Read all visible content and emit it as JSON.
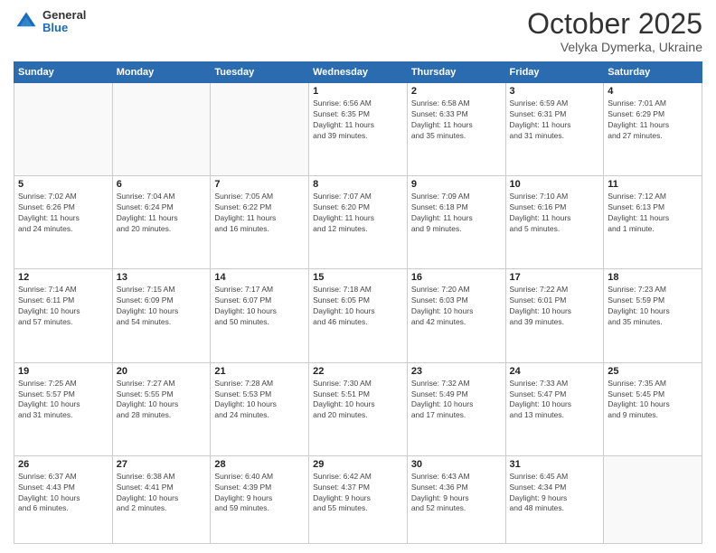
{
  "header": {
    "logo": {
      "general": "General",
      "blue": "Blue"
    },
    "title": "October 2025",
    "subtitle": "Velyka Dymerka, Ukraine"
  },
  "weekdays": [
    "Sunday",
    "Monday",
    "Tuesday",
    "Wednesday",
    "Thursday",
    "Friday",
    "Saturday"
  ],
  "weeks": [
    [
      {
        "day": "",
        "info": ""
      },
      {
        "day": "",
        "info": ""
      },
      {
        "day": "",
        "info": ""
      },
      {
        "day": "1",
        "info": "Sunrise: 6:56 AM\nSunset: 6:35 PM\nDaylight: 11 hours\nand 39 minutes."
      },
      {
        "day": "2",
        "info": "Sunrise: 6:58 AM\nSunset: 6:33 PM\nDaylight: 11 hours\nand 35 minutes."
      },
      {
        "day": "3",
        "info": "Sunrise: 6:59 AM\nSunset: 6:31 PM\nDaylight: 11 hours\nand 31 minutes."
      },
      {
        "day": "4",
        "info": "Sunrise: 7:01 AM\nSunset: 6:29 PM\nDaylight: 11 hours\nand 27 minutes."
      }
    ],
    [
      {
        "day": "5",
        "info": "Sunrise: 7:02 AM\nSunset: 6:26 PM\nDaylight: 11 hours\nand 24 minutes."
      },
      {
        "day": "6",
        "info": "Sunrise: 7:04 AM\nSunset: 6:24 PM\nDaylight: 11 hours\nand 20 minutes."
      },
      {
        "day": "7",
        "info": "Sunrise: 7:05 AM\nSunset: 6:22 PM\nDaylight: 11 hours\nand 16 minutes."
      },
      {
        "day": "8",
        "info": "Sunrise: 7:07 AM\nSunset: 6:20 PM\nDaylight: 11 hours\nand 12 minutes."
      },
      {
        "day": "9",
        "info": "Sunrise: 7:09 AM\nSunset: 6:18 PM\nDaylight: 11 hours\nand 9 minutes."
      },
      {
        "day": "10",
        "info": "Sunrise: 7:10 AM\nSunset: 6:16 PM\nDaylight: 11 hours\nand 5 minutes."
      },
      {
        "day": "11",
        "info": "Sunrise: 7:12 AM\nSunset: 6:13 PM\nDaylight: 11 hours\nand 1 minute."
      }
    ],
    [
      {
        "day": "12",
        "info": "Sunrise: 7:14 AM\nSunset: 6:11 PM\nDaylight: 10 hours\nand 57 minutes."
      },
      {
        "day": "13",
        "info": "Sunrise: 7:15 AM\nSunset: 6:09 PM\nDaylight: 10 hours\nand 54 minutes."
      },
      {
        "day": "14",
        "info": "Sunrise: 7:17 AM\nSunset: 6:07 PM\nDaylight: 10 hours\nand 50 minutes."
      },
      {
        "day": "15",
        "info": "Sunrise: 7:18 AM\nSunset: 6:05 PM\nDaylight: 10 hours\nand 46 minutes."
      },
      {
        "day": "16",
        "info": "Sunrise: 7:20 AM\nSunset: 6:03 PM\nDaylight: 10 hours\nand 42 minutes."
      },
      {
        "day": "17",
        "info": "Sunrise: 7:22 AM\nSunset: 6:01 PM\nDaylight: 10 hours\nand 39 minutes."
      },
      {
        "day": "18",
        "info": "Sunrise: 7:23 AM\nSunset: 5:59 PM\nDaylight: 10 hours\nand 35 minutes."
      }
    ],
    [
      {
        "day": "19",
        "info": "Sunrise: 7:25 AM\nSunset: 5:57 PM\nDaylight: 10 hours\nand 31 minutes."
      },
      {
        "day": "20",
        "info": "Sunrise: 7:27 AM\nSunset: 5:55 PM\nDaylight: 10 hours\nand 28 minutes."
      },
      {
        "day": "21",
        "info": "Sunrise: 7:28 AM\nSunset: 5:53 PM\nDaylight: 10 hours\nand 24 minutes."
      },
      {
        "day": "22",
        "info": "Sunrise: 7:30 AM\nSunset: 5:51 PM\nDaylight: 10 hours\nand 20 minutes."
      },
      {
        "day": "23",
        "info": "Sunrise: 7:32 AM\nSunset: 5:49 PM\nDaylight: 10 hours\nand 17 minutes."
      },
      {
        "day": "24",
        "info": "Sunrise: 7:33 AM\nSunset: 5:47 PM\nDaylight: 10 hours\nand 13 minutes."
      },
      {
        "day": "25",
        "info": "Sunrise: 7:35 AM\nSunset: 5:45 PM\nDaylight: 10 hours\nand 9 minutes."
      }
    ],
    [
      {
        "day": "26",
        "info": "Sunrise: 6:37 AM\nSunset: 4:43 PM\nDaylight: 10 hours\nand 6 minutes."
      },
      {
        "day": "27",
        "info": "Sunrise: 6:38 AM\nSunset: 4:41 PM\nDaylight: 10 hours\nand 2 minutes."
      },
      {
        "day": "28",
        "info": "Sunrise: 6:40 AM\nSunset: 4:39 PM\nDaylight: 9 hours\nand 59 minutes."
      },
      {
        "day": "29",
        "info": "Sunrise: 6:42 AM\nSunset: 4:37 PM\nDaylight: 9 hours\nand 55 minutes."
      },
      {
        "day": "30",
        "info": "Sunrise: 6:43 AM\nSunset: 4:36 PM\nDaylight: 9 hours\nand 52 minutes."
      },
      {
        "day": "31",
        "info": "Sunrise: 6:45 AM\nSunset: 4:34 PM\nDaylight: 9 hours\nand 48 minutes."
      },
      {
        "day": "",
        "info": ""
      }
    ]
  ]
}
